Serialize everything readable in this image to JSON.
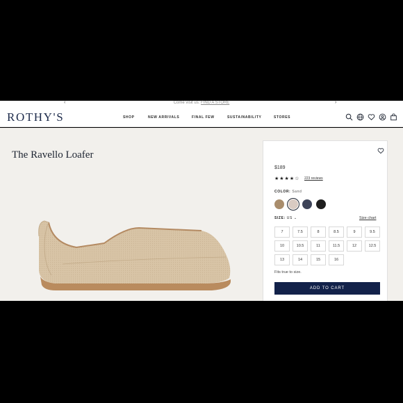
{
  "promo": {
    "text": "Come visit us: ",
    "link": "FIND A STORE"
  },
  "header": {
    "logo": "ROTHY'S",
    "nav": [
      "SHOP",
      "NEW ARRIVALS",
      "FINAL FEW",
      "SUSTAINABILITY",
      "STORES"
    ],
    "icons": [
      "search-icon",
      "globe-icon",
      "heart-icon",
      "account-icon",
      "bag-icon"
    ]
  },
  "product": {
    "title": "The Ravello Loafer",
    "price": "$189",
    "stars": "★★★★☆",
    "rating": 4,
    "reviews": "223 reviews",
    "color_label": "COLOR:",
    "color_value": "Sand",
    "swatches": [
      "#a98d6c",
      "#d9cbc2",
      "#3d4358",
      "#1e1e1e"
    ],
    "selected_swatch": 1,
    "size_label": "SIZE:",
    "size_region": "US",
    "size_chart": "Size chart",
    "sizes": [
      "7",
      "7.5",
      "8",
      "8.5",
      "9",
      "9.5",
      "10",
      "10.5",
      "11",
      "11.5",
      "12",
      "12.5",
      "13",
      "14",
      "15",
      "16"
    ],
    "fit_note": "Fits true to size.",
    "add_to_cart": "ADD TO CART"
  },
  "colors": {
    "brand_navy": "#13224a",
    "panel_bg": "#f2f0ec"
  }
}
